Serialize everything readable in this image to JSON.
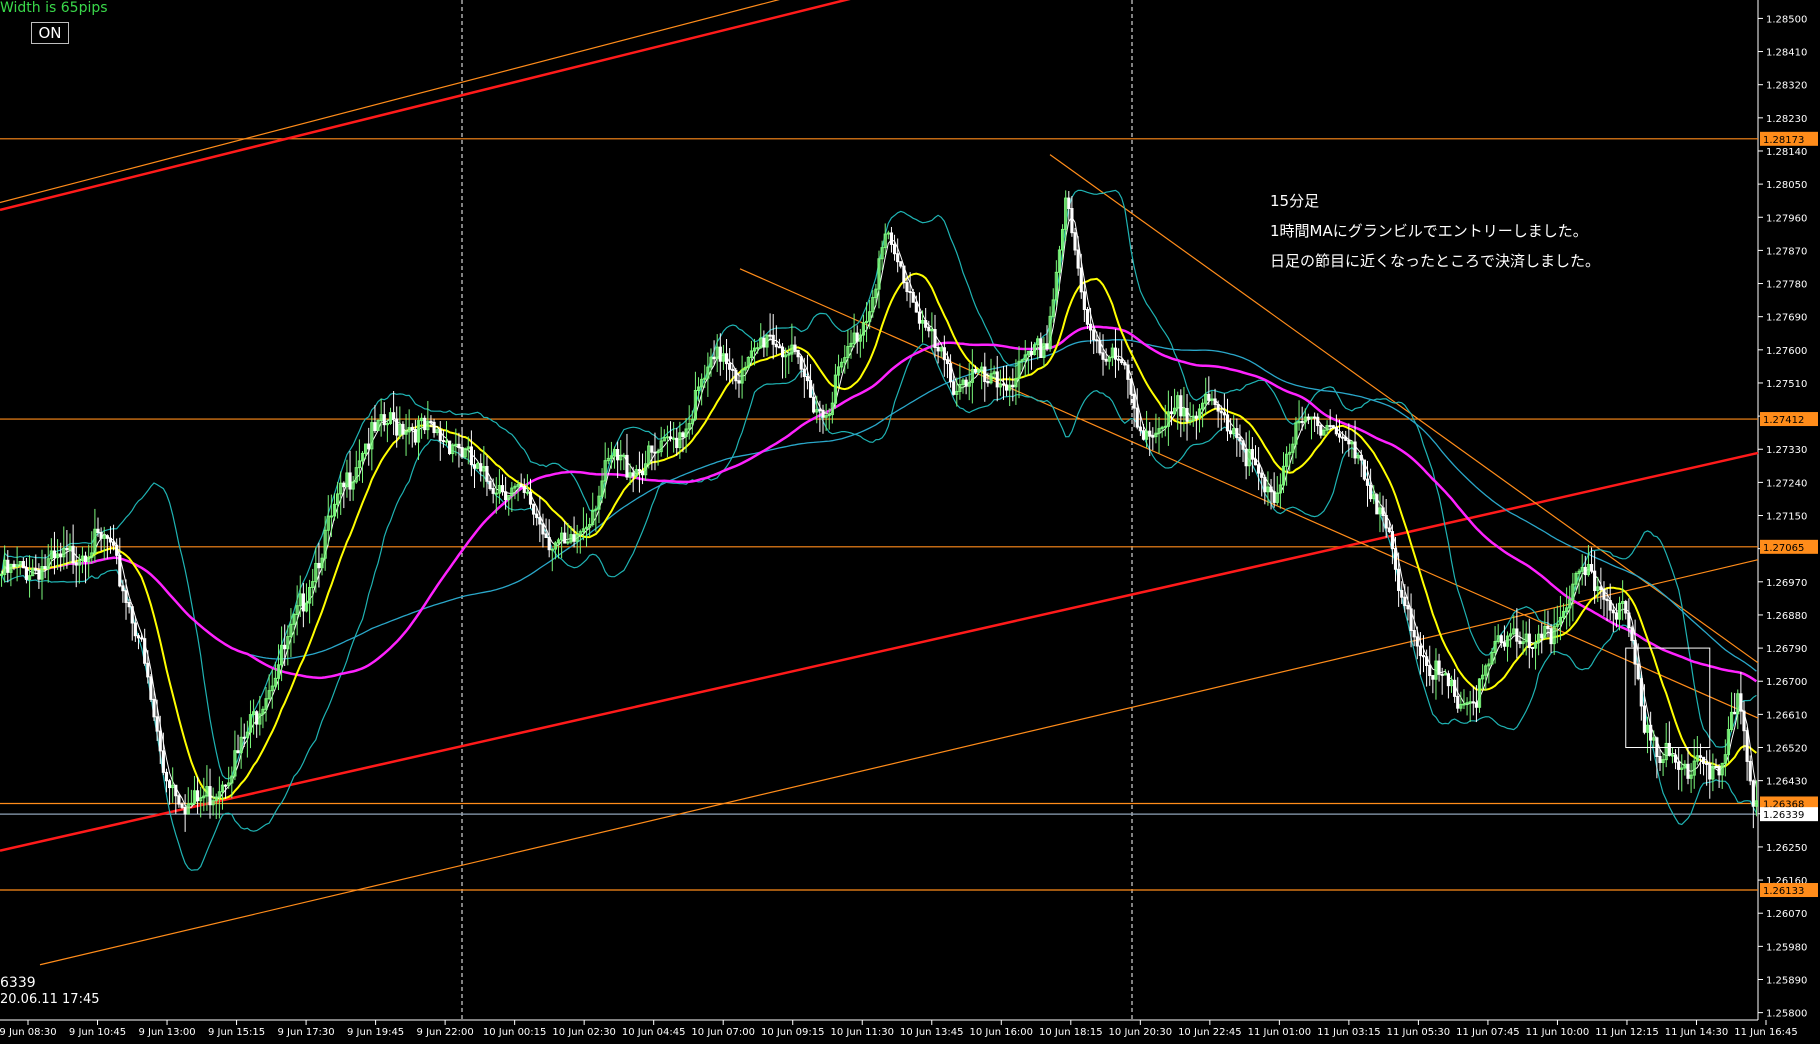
{
  "header": {
    "width_label": "Width is 65pips",
    "toggle_label": "ON"
  },
  "annotation": {
    "lines": [
      "15分足",
      "1時間MAにグランビルでエントリーしました。",
      "日足の節目に近くなったところで決済しました。"
    ]
  },
  "footer": {
    "price": "6339",
    "datetime": "20.06.11 17:45"
  },
  "colors": {
    "background": "#000000",
    "bull": "#7cf87c",
    "bear": "#ffffff",
    "ma_fast": "#ffffff",
    "ma_yellow": "#ffff00",
    "ma_magenta": "#ff22ff",
    "ma_blue": "#2aa7c9",
    "bollinger": "#1fb3b3",
    "trend_red": "#ff1a1a",
    "trend_orange": "#ff8c1a"
  },
  "chart_data": {
    "type": "candlestick",
    "symbol_timeframe": "15分足",
    "ylim": [
      1.2578,
      1.2855
    ],
    "y_ticks": [
      "1.28500",
      "1.28410",
      "1.28320",
      "1.28230",
      "1.28140",
      "1.28050",
      "1.27960",
      "1.27870",
      "1.27780",
      "1.27690",
      "1.27600",
      "1.27510",
      "1.27420",
      "1.27330",
      "1.27240",
      "1.27150",
      "1.27060",
      "1.26970",
      "1.26880",
      "1.26790",
      "1.26700",
      "1.26610",
      "1.26520",
      "1.26430",
      "1.26340",
      "1.26250",
      "1.26160",
      "1.26070",
      "1.25980",
      "1.25890",
      "1.25800"
    ],
    "x_ticks": [
      "9 Jun 08:30",
      "9 Jun 10:45",
      "9 Jun 13:00",
      "9 Jun 15:15",
      "9 Jun 17:30",
      "9 Jun 19:45",
      "9 Jun 22:00",
      "10 Jun 00:15",
      "10 Jun 02:30",
      "10 Jun 04:45",
      "10 Jun 07:00",
      "10 Jun 09:15",
      "10 Jun 11:30",
      "10 Jun 13:45",
      "10 Jun 16:00",
      "10 Jun 18:15",
      "10 Jun 20:30",
      "10 Jun 22:45",
      "11 Jun 01:00",
      "11 Jun 03:15",
      "11 Jun 05:30",
      "11 Jun 07:45",
      "11 Jun 10:00",
      "11 Jun 12:15",
      "11 Jun 14:30",
      "11 Jun 16:45"
    ],
    "close_path": [
      [
        0,
        1.2699
      ],
      [
        18,
        1.2702
      ],
      [
        28,
        1.2707
      ],
      [
        34,
        1.2708
      ],
      [
        44,
        1.2683
      ],
      [
        52,
        1.2646
      ],
      [
        60,
        1.2636
      ],
      [
        68,
        1.264
      ],
      [
        76,
        1.265
      ],
      [
        84,
        1.2666
      ],
      [
        92,
        1.268
      ],
      [
        100,
        1.27
      ],
      [
        108,
        1.2718
      ],
      [
        116,
        1.2734
      ],
      [
        124,
        1.274
      ],
      [
        130,
        1.274
      ],
      [
        138,
        1.2737
      ],
      [
        146,
        1.2735
      ],
      [
        154,
        1.2725
      ],
      [
        162,
        1.2723
      ],
      [
        170,
        1.2718
      ],
      [
        176,
        1.2709
      ],
      [
        182,
        1.2705
      ],
      [
        188,
        1.2714
      ],
      [
        196,
        1.273
      ],
      [
        204,
        1.2728
      ],
      [
        212,
        1.2732
      ],
      [
        220,
        1.274
      ],
      [
        226,
        1.2752
      ],
      [
        232,
        1.276
      ],
      [
        238,
        1.2752
      ],
      [
        246,
        1.2765
      ],
      [
        252,
        1.276
      ],
      [
        258,
        1.2752
      ],
      [
        264,
        1.2742
      ],
      [
        270,
        1.2755
      ],
      [
        278,
        1.277
      ],
      [
        284,
        1.279
      ],
      [
        292,
        1.2776
      ],
      [
        300,
        1.276
      ],
      [
        306,
        1.2751
      ],
      [
        312,
        1.2753
      ],
      [
        318,
        1.275
      ],
      [
        324,
        1.2752
      ],
      [
        330,
        1.2756
      ],
      [
        336,
        1.2763
      ],
      [
        342,
        1.28
      ],
      [
        348,
        1.277
      ],
      [
        354,
        1.276
      ],
      [
        360,
        1.2755
      ],
      [
        366,
        1.274
      ],
      [
        372,
        1.2735
      ],
      [
        378,
        1.2744
      ],
      [
        384,
        1.2745
      ],
      [
        390,
        1.2743
      ],
      [
        396,
        1.274
      ],
      [
        402,
        1.2728
      ],
      [
        408,
        1.2718
      ],
      [
        414,
        1.2735
      ],
      [
        420,
        1.274
      ],
      [
        426,
        1.2741
      ],
      [
        432,
        1.2735
      ],
      [
        438,
        1.2726
      ],
      [
        444,
        1.2716
      ],
      [
        450,
        1.269
      ],
      [
        456,
        1.268
      ],
      [
        462,
        1.267
      ],
      [
        468,
        1.2665
      ],
      [
        474,
        1.2665
      ],
      [
        480,
        1.2678
      ],
      [
        486,
        1.2685
      ],
      [
        492,
        1.2677
      ],
      [
        498,
        1.2683
      ],
      [
        504,
        1.2695
      ],
      [
        510,
        1.2698
      ],
      [
        516,
        1.2694
      ],
      [
        522,
        1.2687
      ],
      [
        528,
        1.266
      ],
      [
        534,
        1.265
      ],
      [
        540,
        1.2645
      ],
      [
        546,
        1.2652
      ],
      [
        552,
        1.2641
      ],
      [
        558,
        1.2668
      ],
      [
        564,
        1.2634
      ]
    ],
    "events": [
      {
        "type": "entry_zone",
        "label": "box",
        "from_bar": 522,
        "to_bar": 549,
        "range": [
          1.2652,
          1.2679
        ]
      }
    ],
    "price_tags": [
      "1.28173",
      "1.27412",
      "1.27065",
      "1.26368",
      "1.26339",
      "1.26133"
    ],
    "current_price": "1.26339"
  }
}
